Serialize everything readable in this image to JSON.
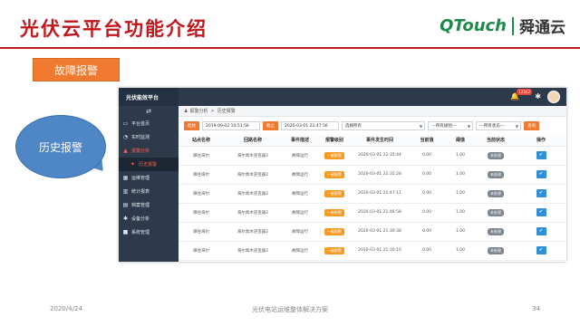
{
  "slide": {
    "title": "光伏云平台功能介绍",
    "section_tag": "故障报警",
    "callout": "历史报警",
    "logo_en": "QTouch",
    "logo_cn": "舜通云",
    "accent_color": "#c0161c",
    "orange_color": "#f07a2f"
  },
  "app": {
    "brand": "光伏能效平台",
    "toggle_icon": "menu-toggle-icon",
    "sidebar": [
      {
        "label": "平台首页",
        "icon": "monitor-icon",
        "glyph": "▭"
      },
      {
        "label": "实时监测",
        "icon": "gauge-icon",
        "glyph": "◔"
      },
      {
        "label": "报警分析",
        "icon": "warning-icon",
        "glyph": "▲"
      },
      {
        "label": "历史报警",
        "icon": "bell-icon",
        "glyph": "✦"
      },
      {
        "label": "运维管理",
        "icon": "calendar-icon",
        "glyph": "▦"
      },
      {
        "label": "统计报表",
        "icon": "bar-chart-icon",
        "glyph": "▥"
      },
      {
        "label": "档案管理",
        "icon": "archive-icon",
        "glyph": "▤"
      },
      {
        "label": "设备分析",
        "icon": "settings-icon",
        "glyph": "✱"
      },
      {
        "label": "系统管理",
        "icon": "folder-icon",
        "glyph": "■"
      }
    ],
    "topbar": {
      "badge": "12342"
    },
    "breadcrumb": {
      "root": "报警分析",
      "separator": ">",
      "current": "历史报警"
    },
    "filters": {
      "start_label": "起始",
      "start_value": "2019-09-02 10:51:56",
      "end_label": "截止",
      "end_value": "2020-03-01 22:47:56",
      "select_type": "选择所有",
      "select_level": "---所有级别---",
      "select_status": "---所有状态---",
      "query_label": "查询"
    },
    "table": {
      "headers": [
        "站点名称",
        "回路名称",
        "事件描述",
        "报警级别",
        "事件发生时间",
        "当前值",
        "阈值",
        "当前状态",
        "操作"
      ],
      "rows": [
        {
          "site": "驿往海尔",
          "loop": "海尔禹木逆变器2",
          "desc": "故障运行",
          "level": "一般报警",
          "time": "2020-03-01 22:35:44",
          "value": "0.00",
          "threshold": "1.00",
          "status": "未处理"
        },
        {
          "site": "驿往海尔",
          "loop": "海尔禹木逆变器2",
          "desc": "故障运行",
          "level": "一般报警",
          "time": "2020-03-01 22:35:28",
          "value": "0.00",
          "threshold": "1.00",
          "status": "未处理"
        },
        {
          "site": "驿往海尔",
          "loop": "海尔禹木逆变器2",
          "desc": "故障运行",
          "level": "一般报警",
          "time": "2020-03-01 21:47:11",
          "value": "0.00",
          "threshold": "1.00",
          "status": "未处理"
        },
        {
          "site": "驿往海尔",
          "loop": "海尔禹木逆变器2",
          "desc": "故障运行",
          "level": "一般报警",
          "time": "2020-03-01 21:46:58",
          "value": "0.00",
          "threshold": "1.00",
          "status": "未处理"
        },
        {
          "site": "驿往海尔",
          "loop": "海尔禹木逆变器2",
          "desc": "故障运行",
          "level": "一般报警",
          "time": "2020-03-01 21:30:38",
          "value": "0.00",
          "threshold": "1.00",
          "status": "未处理"
        },
        {
          "site": "驿往海尔",
          "loop": "海尔禹木逆变器2",
          "desc": "故障运行",
          "level": "一般报警",
          "time": "2020-03-01 21:30:10",
          "value": "0.00",
          "threshold": "1.00",
          "status": "未处理"
        }
      ]
    }
  },
  "footer": {
    "date": "2020/4/24",
    "center": "光伏电站运维整体解决方案",
    "page": "34"
  }
}
